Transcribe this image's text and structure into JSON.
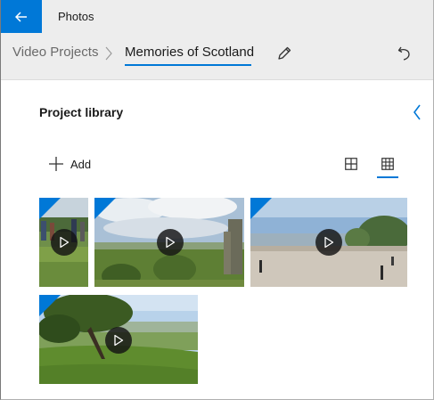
{
  "app": {
    "title": "Photos"
  },
  "breadcrumb": {
    "root": "Video Projects",
    "current": "Memories of Scotland"
  },
  "library": {
    "title": "Project library",
    "add_label": "Add"
  },
  "colors": {
    "accent": "#0078d7",
    "titlebar": "#ededed"
  },
  "icons": {
    "back": "back-arrow-icon",
    "chevron": "chevron-right-icon",
    "edit": "pencil-icon",
    "undo": "undo-icon",
    "collapse": "chevron-left-icon",
    "add": "plus-icon",
    "large_grid": "large-grid-icon",
    "small_grid": "small-grid-icon",
    "play": "play-icon"
  },
  "clips": [
    {
      "id": "clip-1",
      "scene": "crowd on grass"
    },
    {
      "id": "clip-2",
      "scene": "castle ruins under cloudy sky"
    },
    {
      "id": "clip-3",
      "scene": "plaza overlooking city"
    },
    {
      "id": "clip-4",
      "scene": "tree on grassy hillside"
    }
  ]
}
